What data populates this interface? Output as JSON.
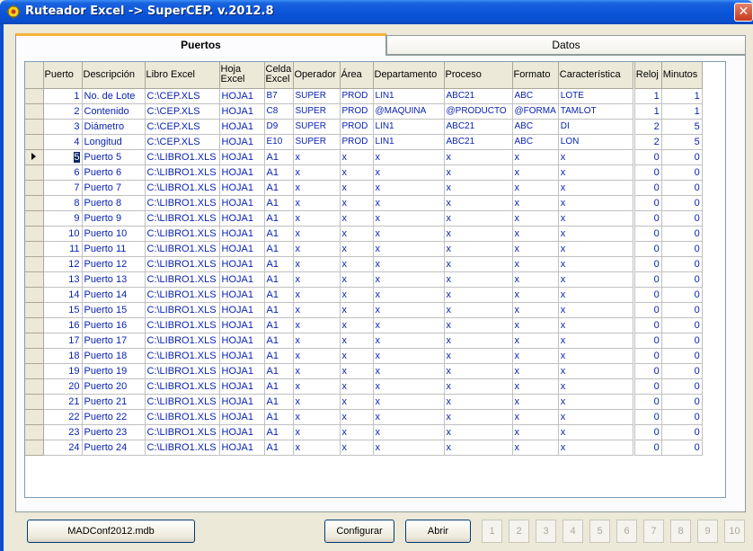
{
  "window": {
    "title": "Ruteador Excel -> SuperCEP. v.2012.8",
    "close_glyph": "✕"
  },
  "tabs": [
    {
      "label": "Puertos",
      "active": true
    },
    {
      "label": "Datos",
      "active": false
    }
  ],
  "grid": {
    "columns": [
      "Puerto",
      "Descripción",
      "Libro Excel",
      "Hoja Excel",
      "Celda Excel",
      "Operador",
      "Área",
      "Departamento",
      "Proceso",
      "Formato",
      "Característica",
      "Reloj",
      "Minutos"
    ],
    "current_row_index": 4,
    "rows": [
      [
        "1",
        "No. de Lote",
        "C:\\CEP.XLS",
        "HOJA1",
        "B7",
        "SUPER",
        "PROD",
        "LIN1",
        "ABC21",
        "ABC",
        "LOTE",
        "1",
        "1"
      ],
      [
        "2",
        "Contenido",
        "C:\\CEP.XLS",
        "HOJA1",
        "C8",
        "SUPER",
        "PROD",
        "@MAQUINA",
        "@PRODUCTO",
        "@FORMA",
        "TAMLOT",
        "1",
        "1"
      ],
      [
        "3",
        "Diámetro",
        "C:\\CEP.XLS",
        "HOJA1",
        "D9",
        "SUPER",
        "PROD",
        "LIN1",
        "ABC21",
        "ABC",
        "DI",
        "2",
        "5"
      ],
      [
        "4",
        "Longitud",
        "C:\\CEP.XLS",
        "HOJA1",
        "E10",
        "SUPER",
        "PROD",
        "LIN1",
        "ABC21",
        "ABC",
        "LON",
        "2",
        "5"
      ],
      [
        "5",
        "Puerto 5",
        "C:\\LIBRO1.XLS",
        "HOJA1",
        "A1",
        "x",
        "x",
        "x",
        "x",
        "x",
        "x",
        "0",
        "0"
      ],
      [
        "6",
        "Puerto 6",
        "C:\\LIBRO1.XLS",
        "HOJA1",
        "A1",
        "x",
        "x",
        "x",
        "x",
        "x",
        "x",
        "0",
        "0"
      ],
      [
        "7",
        "Puerto 7",
        "C:\\LIBRO1.XLS",
        "HOJA1",
        "A1",
        "x",
        "x",
        "x",
        "x",
        "x",
        "x",
        "0",
        "0"
      ],
      [
        "8",
        "Puerto 8",
        "C:\\LIBRO1.XLS",
        "HOJA1",
        "A1",
        "x",
        "x",
        "x",
        "x",
        "x",
        "x",
        "0",
        "0"
      ],
      [
        "9",
        "Puerto 9",
        "C:\\LIBRO1.XLS",
        "HOJA1",
        "A1",
        "x",
        "x",
        "x",
        "x",
        "x",
        "x",
        "0",
        "0"
      ],
      [
        "10",
        "Puerto 10",
        "C:\\LIBRO1.XLS",
        "HOJA1",
        "A1",
        "x",
        "x",
        "x",
        "x",
        "x",
        "x",
        "0",
        "0"
      ],
      [
        "11",
        "Puerto 11",
        "C:\\LIBRO1.XLS",
        "HOJA1",
        "A1",
        "x",
        "x",
        "x",
        "x",
        "x",
        "x",
        "0",
        "0"
      ],
      [
        "12",
        "Puerto 12",
        "C:\\LIBRO1.XLS",
        "HOJA1",
        "A1",
        "x",
        "x",
        "x",
        "x",
        "x",
        "x",
        "0",
        "0"
      ],
      [
        "13",
        "Puerto 13",
        "C:\\LIBRO1.XLS",
        "HOJA1",
        "A1",
        "x",
        "x",
        "x",
        "x",
        "x",
        "x",
        "0",
        "0"
      ],
      [
        "14",
        "Puerto 14",
        "C:\\LIBRO1.XLS",
        "HOJA1",
        "A1",
        "x",
        "x",
        "x",
        "x",
        "x",
        "x",
        "0",
        "0"
      ],
      [
        "15",
        "Puerto 15",
        "C:\\LIBRO1.XLS",
        "HOJA1",
        "A1",
        "x",
        "x",
        "x",
        "x",
        "x",
        "x",
        "0",
        "0"
      ],
      [
        "16",
        "Puerto 16",
        "C:\\LIBRO1.XLS",
        "HOJA1",
        "A1",
        "x",
        "x",
        "x",
        "x",
        "x",
        "x",
        "0",
        "0"
      ],
      [
        "17",
        "Puerto 17",
        "C:\\LIBRO1.XLS",
        "HOJA1",
        "A1",
        "x",
        "x",
        "x",
        "x",
        "x",
        "x",
        "0",
        "0"
      ],
      [
        "18",
        "Puerto 18",
        "C:\\LIBRO1.XLS",
        "HOJA1",
        "A1",
        "x",
        "x",
        "x",
        "x",
        "x",
        "x",
        "0",
        "0"
      ],
      [
        "19",
        "Puerto 19",
        "C:\\LIBRO1.XLS",
        "HOJA1",
        "A1",
        "x",
        "x",
        "x",
        "x",
        "x",
        "x",
        "0",
        "0"
      ],
      [
        "20",
        "Puerto 20",
        "C:\\LIBRO1.XLS",
        "HOJA1",
        "A1",
        "x",
        "x",
        "x",
        "x",
        "x",
        "x",
        "0",
        "0"
      ],
      [
        "21",
        "Puerto 21",
        "C:\\LIBRO1.XLS",
        "HOJA1",
        "A1",
        "x",
        "x",
        "x",
        "x",
        "x",
        "x",
        "0",
        "0"
      ],
      [
        "22",
        "Puerto 22",
        "C:\\LIBRO1.XLS",
        "HOJA1",
        "A1",
        "x",
        "x",
        "x",
        "x",
        "x",
        "x",
        "0",
        "0"
      ],
      [
        "23",
        "Puerto 23",
        "C:\\LIBRO1.XLS",
        "HOJA1",
        "A1",
        "x",
        "x",
        "x",
        "x",
        "x",
        "x",
        "0",
        "0"
      ],
      [
        "24",
        "Puerto 24",
        "C:\\LIBRO1.XLS",
        "HOJA1",
        "A1",
        "x",
        "x",
        "x",
        "x",
        "x",
        "x",
        "0",
        "0"
      ]
    ]
  },
  "footer": {
    "db_button": "MADConf2012.mdb",
    "configurar": "Configurar",
    "abrir": "Abrir",
    "port_buttons": [
      "1",
      "2",
      "3",
      "4",
      "5",
      "6",
      "7",
      "8",
      "9",
      "10"
    ]
  }
}
